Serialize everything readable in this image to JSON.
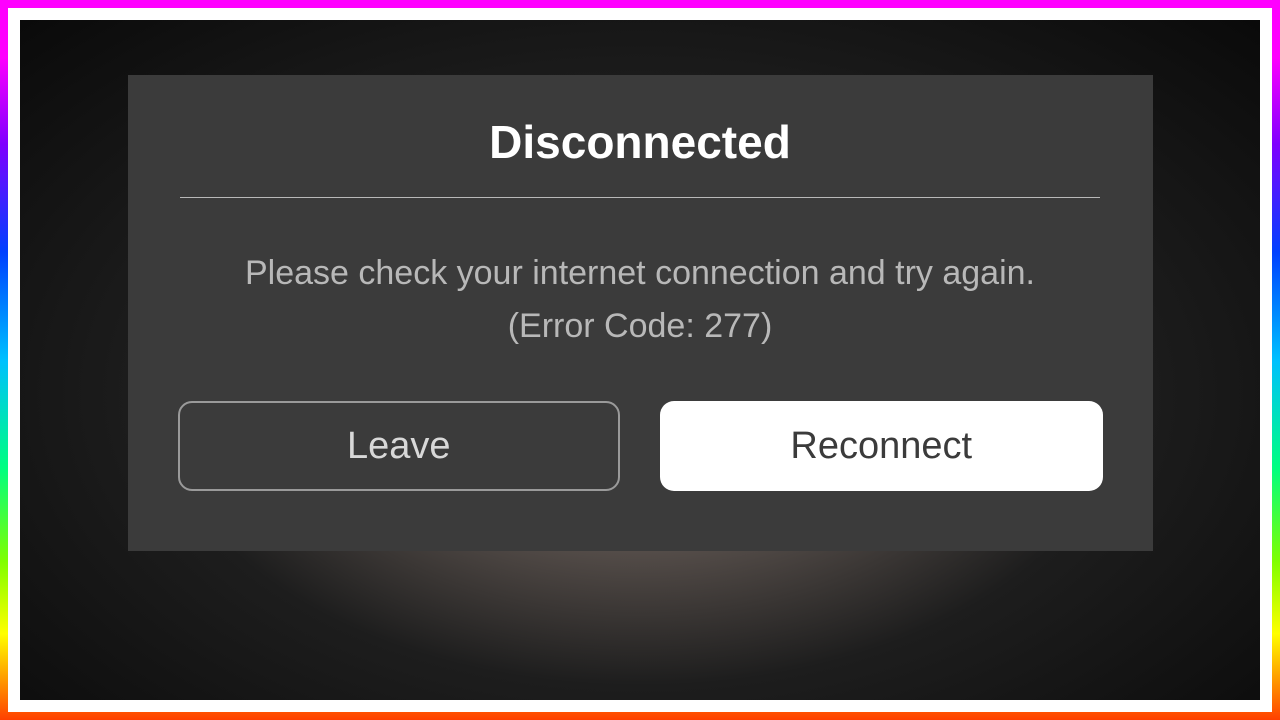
{
  "dialog": {
    "title": "Disconnected",
    "message": "Please check your internet connection and try again.",
    "error": "(Error Code: 277)",
    "leave_label": "Leave",
    "reconnect_label": "Reconnect"
  }
}
